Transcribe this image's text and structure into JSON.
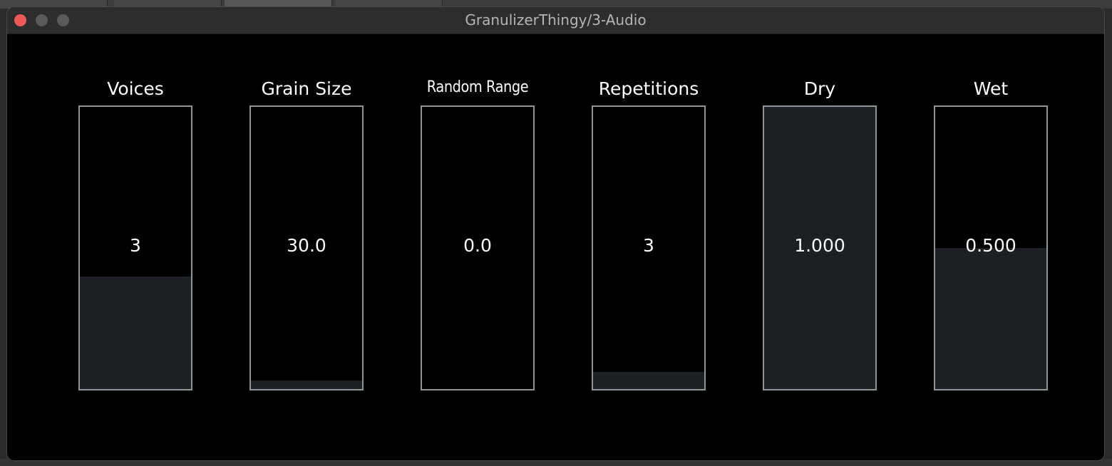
{
  "window": {
    "title": "GranulizerThingy/3-Audio"
  },
  "colors": {
    "background": "#000000",
    "slider_border": "#8e9396",
    "slider_fill": "#1c2024",
    "text": "#ffffff",
    "close_button": "#ed5a55"
  },
  "sliders": [
    {
      "label": "Voices",
      "value": "3",
      "level": 0.4
    },
    {
      "label": "Grain Size",
      "value": "30.0",
      "level": 0.03
    },
    {
      "label": "Random Range",
      "value": "0.0",
      "level": 0.0
    },
    {
      "label": "Repetitions",
      "value": "3",
      "level": 0.06
    },
    {
      "label": "Dry",
      "value": "1.000",
      "level": 1.0
    },
    {
      "label": "Wet",
      "value": "0.500",
      "level": 0.5
    }
  ]
}
